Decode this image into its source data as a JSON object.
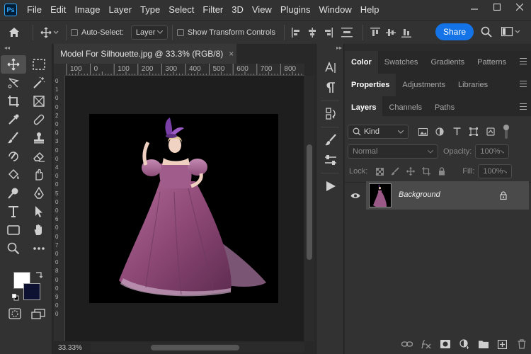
{
  "app": {
    "logo": "Ps"
  },
  "menu": [
    "File",
    "Edit",
    "Image",
    "Layer",
    "Type",
    "Select",
    "Filter",
    "3D",
    "View",
    "Plugins",
    "Window",
    "Help"
  ],
  "options_bar": {
    "auto_select_label": "Auto-Select:",
    "auto_select_value": "Layer",
    "show_transform_label": "Show Transform Controls",
    "share_label": "Share"
  },
  "document": {
    "tab_title": "Model For  Silhouette.jpg @ 33.3% (RGB/8)",
    "close_glyph": "×",
    "zoom_status": "33.33%",
    "ruler_h": [
      "100",
      "0",
      "100",
      "200",
      "300",
      "400",
      "500",
      "600",
      "700",
      "800"
    ],
    "ruler_v": [
      "0",
      "1",
      "0",
      "0",
      "2",
      "0",
      "0",
      "3",
      "0",
      "0",
      "4",
      "0",
      "0",
      "5",
      "0",
      "0",
      "6",
      "0",
      "0",
      "7",
      "0",
      "0",
      "8",
      "0",
      "0",
      "9",
      "0",
      "0"
    ]
  },
  "panels": {
    "row1_tabs": [
      "Color",
      "Swatches",
      "Gradients",
      "Patterns"
    ],
    "row2_tabs": [
      "Properties",
      "Adjustments",
      "Libraries"
    ],
    "row3_tabs": [
      "Layers",
      "Channels",
      "Paths"
    ],
    "layers": {
      "filter_kind": "Kind",
      "blend_mode": "Normal",
      "opacity_label": "Opacity:",
      "opacity_value": "100%",
      "lock_label": "Lock:",
      "fill_label": "Fill:",
      "fill_value": "100%",
      "items": [
        {
          "name": "Background"
        }
      ]
    }
  },
  "colors": {
    "foreground": "#ffffff",
    "background": "#0d1233",
    "accent": "#1473e6"
  }
}
